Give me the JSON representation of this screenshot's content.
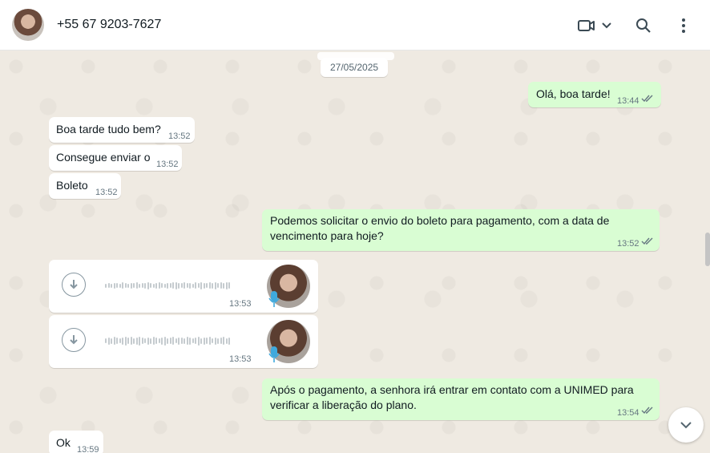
{
  "header": {
    "contact_name": "+55 67 9203-7627",
    "icons": [
      "video-call-icon",
      "chevron-down-icon",
      "search-icon",
      "menu-icon"
    ]
  },
  "chat": {
    "date_separator": "27/05/2025",
    "messages": [
      {
        "direction": "out",
        "text": "Olá, boa tarde!",
        "time": "13:44",
        "status": "read"
      },
      {
        "direction": "in",
        "text": "Boa tarde tudo bem?",
        "time": "13:52"
      },
      {
        "direction": "in",
        "text": "Consegue enviar o",
        "time": "13:52"
      },
      {
        "direction": "in",
        "text": "Boleto",
        "time": "13:52"
      },
      {
        "direction": "out",
        "text_line1": "Podemos solicitar o envio do boleto para pagamento, com a data de",
        "text_line2": "vencimento para hoje?",
        "time": "13:52",
        "status": "read"
      },
      {
        "direction": "in",
        "type": "audio",
        "time": "13:53"
      },
      {
        "direction": "in",
        "type": "audio",
        "time": "13:53"
      },
      {
        "direction": "out",
        "text_line1": "Após o pagamento, a senhora irá entrar em contato com a UNIMED para",
        "text_line2": "verificar a liberação do plano.",
        "time": "13:54",
        "status": "read"
      },
      {
        "direction": "in",
        "text": "Ok",
        "time": "13:59"
      }
    ]
  },
  "colors": {
    "incoming_bubble": "#ffffff",
    "outgoing_bubble": "#d9fdd3",
    "background": "#efeae2",
    "read_ticks": "#53bdeb",
    "mic_accent": "#3fa9dd"
  }
}
